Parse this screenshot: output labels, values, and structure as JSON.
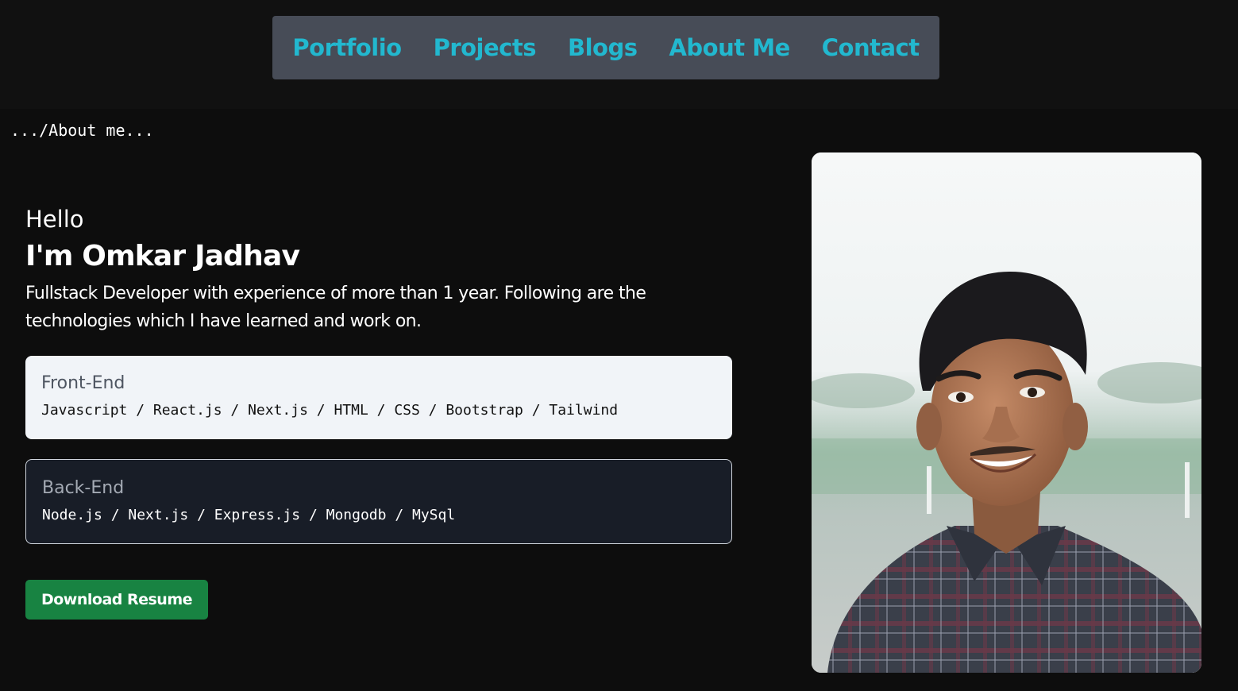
{
  "nav": {
    "items": [
      "Portfolio",
      "Projects",
      "Blogs",
      "About Me",
      "Contact"
    ]
  },
  "breadcrumb": ".../About me...",
  "hero": {
    "greeting": "Hello",
    "name": "I'm Omkar Jadhav",
    "intro": "Fullstack Developer with experience of more than 1 year. Following are the technologies which I have learned and work on."
  },
  "skills": {
    "frontend": {
      "title": "Front-End",
      "tech": "Javascript / React.js / Next.js / HTML / CSS / Bootstrap / Tailwind"
    },
    "backend": {
      "title": "Back-End",
      "tech": "Node.js / Next.js / Express.js / Mongodb / MySql"
    }
  },
  "cta": {
    "download_label": "Download Resume"
  },
  "colors": {
    "accent": "#22b8cf",
    "button_green": "#188342",
    "navbar_bg": "#474c57",
    "page_bg": "#0d0d0d"
  }
}
